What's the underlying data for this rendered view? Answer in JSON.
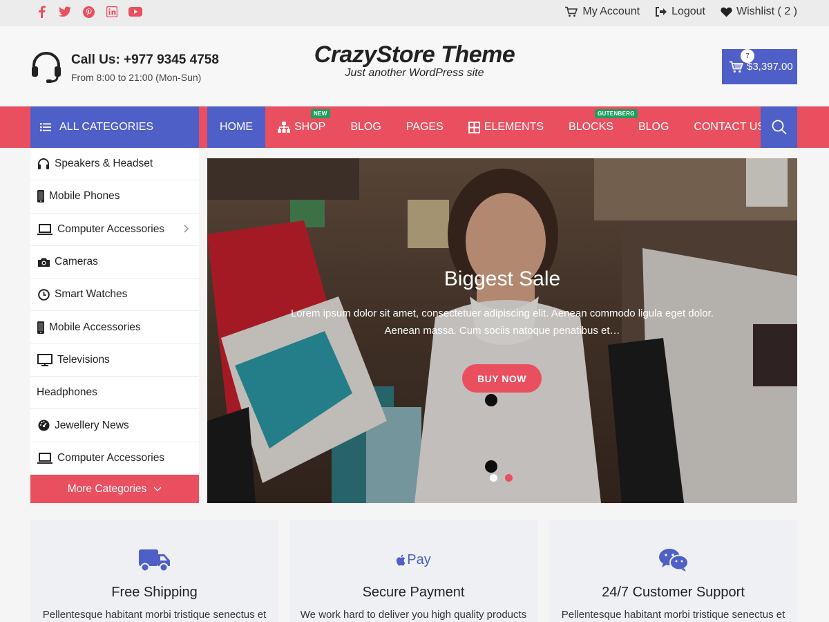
{
  "topbar": {
    "social": [
      "facebook-icon",
      "twitter-icon",
      "pinterest-icon",
      "linkedin-icon",
      "youtube-icon"
    ],
    "my_account": "My Account",
    "logout": "Logout",
    "wishlist": "Wishlist ( 2 )"
  },
  "header": {
    "call_title": "Call Us: +977 9345 4758",
    "call_hours": "From 8:00 to 21:00 (Mon-Sun)",
    "site_title": "CrazyStore Theme",
    "tagline": "Just another WordPress site",
    "cart_count": "7",
    "cart_total": "$3,397.00"
  },
  "nav": {
    "all_categories": "ALL CATEGORIES",
    "items": [
      {
        "label": "HOME"
      },
      {
        "label": "SHOP",
        "badge": "NEW"
      },
      {
        "label": "BLOG"
      },
      {
        "label": "PAGES"
      },
      {
        "label": "ELEMENTS"
      },
      {
        "label": "BLOCKS",
        "badge": "GUTENBERG"
      },
      {
        "label": "BLOG"
      },
      {
        "label": "CONTACT US"
      }
    ]
  },
  "sidebar": {
    "categories": [
      {
        "label": "Speakers & Headset",
        "icon": "headphones-icon"
      },
      {
        "label": "Mobile Phones",
        "icon": "mobile-icon"
      },
      {
        "label": "Computer Accessories",
        "icon": "laptop-icon"
      },
      {
        "label": "Cameras",
        "icon": "camera-icon"
      },
      {
        "label": "Smart Watches",
        "icon": "clock-icon"
      },
      {
        "label": "Mobile Accessories",
        "icon": "mobile-icon"
      },
      {
        "label": "Televisions",
        "icon": "tv-icon"
      },
      {
        "label": "Headphones",
        "icon": ""
      },
      {
        "label": "Jewellery News",
        "icon": "gauge-icon"
      },
      {
        "label": "Computer Accessories",
        "icon": "laptop-icon"
      }
    ],
    "more": "More Categories"
  },
  "hero": {
    "title": "Biggest Sale",
    "description": "Lorem ipsum dolor sit amet, consectetuer adipiscing elit. Aenean commodo ligula eget dolor. Aenean massa. Cum sociis natoque penatibus et…",
    "button": "BUY NOW",
    "slides": 2,
    "active_slide": 1
  },
  "features": [
    {
      "title": "Free Shipping",
      "desc": "Pellentesque habitant morbi tristique senectus et",
      "icon": "truck-icon"
    },
    {
      "title": "Secure Payment",
      "desc": "We work hard to deliver you high quality products",
      "icon": "apple-pay-icon",
      "icon_text": "Pay"
    },
    {
      "title": "24/7 Customer Support",
      "desc": "Pellentesque habitant morbi tristique senectus et",
      "icon": "wechat-icon"
    }
  ],
  "colors": {
    "accent_red": "#ea4f5f",
    "accent_blue": "#4f5fc8"
  }
}
